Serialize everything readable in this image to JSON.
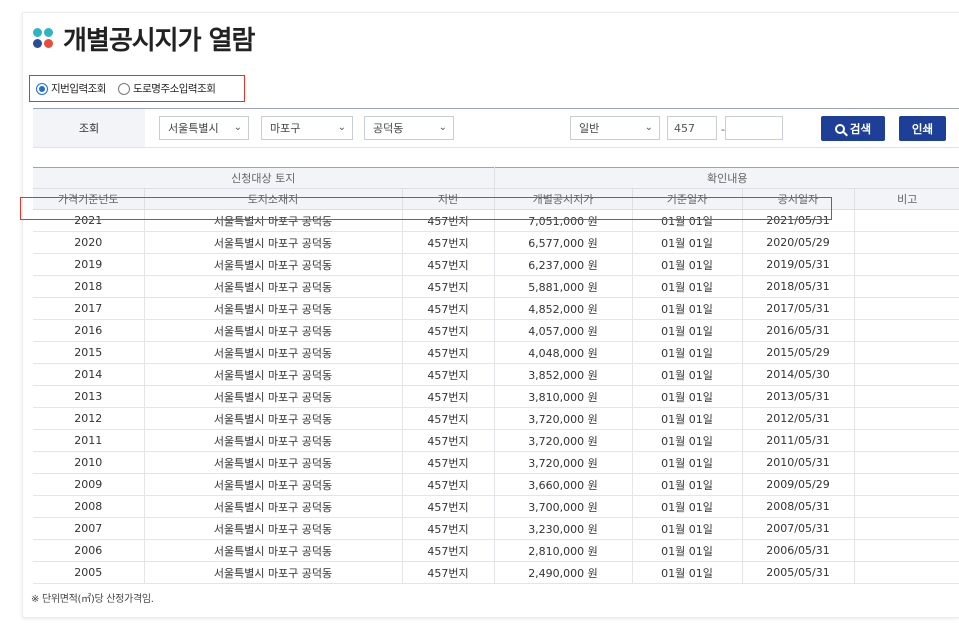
{
  "page": {
    "title": "개별공시지가 열람",
    "footnote": "※ 단위면적(㎡)당 산정가격임."
  },
  "radio": {
    "options": [
      {
        "label": "지번입력조회",
        "selected": true
      },
      {
        "label": "도로명주소입력조회",
        "selected": false
      }
    ]
  },
  "search": {
    "label": "조회",
    "sido": "서울특별시",
    "sigungu": "마포구",
    "dong": "공덕동",
    "land_type": "일반",
    "bonbun": "457",
    "bubun": "",
    "dash": "-",
    "search_button": "검색",
    "print_button": "인쇄"
  },
  "table": {
    "group_headers": [
      "신청대상 토지",
      "확인내용"
    ],
    "columns": [
      "가격기준년도",
      "토지소재지",
      "지번",
      "개별공시지가",
      "기준일자",
      "공시일자",
      "비고"
    ],
    "rows": [
      [
        "2021",
        "서울특별시 마포구 공덕동",
        "457번지",
        "7,051,000 원",
        "01월 01일",
        "2021/05/31",
        ""
      ],
      [
        "2020",
        "서울특별시 마포구 공덕동",
        "457번지",
        "6,577,000 원",
        "01월 01일",
        "2020/05/29",
        ""
      ],
      [
        "2019",
        "서울특별시 마포구 공덕동",
        "457번지",
        "6,237,000 원",
        "01월 01일",
        "2019/05/31",
        ""
      ],
      [
        "2018",
        "서울특별시 마포구 공덕동",
        "457번지",
        "5,881,000 원",
        "01월 01일",
        "2018/05/31",
        ""
      ],
      [
        "2017",
        "서울특별시 마포구 공덕동",
        "457번지",
        "4,852,000 원",
        "01월 01일",
        "2017/05/31",
        ""
      ],
      [
        "2016",
        "서울특별시 마포구 공덕동",
        "457번지",
        "4,057,000 원",
        "01월 01일",
        "2016/05/31",
        ""
      ],
      [
        "2015",
        "서울특별시 마포구 공덕동",
        "457번지",
        "4,048,000 원",
        "01월 01일",
        "2015/05/29",
        ""
      ],
      [
        "2014",
        "서울특별시 마포구 공덕동",
        "457번지",
        "3,852,000 원",
        "01월 01일",
        "2014/05/30",
        ""
      ],
      [
        "2013",
        "서울특별시 마포구 공덕동",
        "457번지",
        "3,810,000 원",
        "01월 01일",
        "2013/05/31",
        ""
      ],
      [
        "2012",
        "서울특별시 마포구 공덕동",
        "457번지",
        "3,720,000 원",
        "01월 01일",
        "2012/05/31",
        ""
      ],
      [
        "2011",
        "서울특별시 마포구 공덕동",
        "457번지",
        "3,720,000 원",
        "01월 01일",
        "2011/05/31",
        ""
      ],
      [
        "2010",
        "서울특별시 마포구 공덕동",
        "457번지",
        "3,720,000 원",
        "01월 01일",
        "2010/05/31",
        ""
      ],
      [
        "2009",
        "서울특별시 마포구 공덕동",
        "457번지",
        "3,660,000 원",
        "01월 01일",
        "2009/05/29",
        ""
      ],
      [
        "2008",
        "서울특별시 마포구 공덕동",
        "457번지",
        "3,700,000 원",
        "01월 01일",
        "2008/05/31",
        ""
      ],
      [
        "2007",
        "서울특별시 마포구 공덕동",
        "457번지",
        "3,230,000 원",
        "01월 01일",
        "2007/05/31",
        ""
      ],
      [
        "2006",
        "서울특별시 마포구 공덕동",
        "457번지",
        "2,810,000 원",
        "01월 01일",
        "2006/05/31",
        ""
      ],
      [
        "2005",
        "서울특별시 마포구 공덕동",
        "457번지",
        "2,490,000 원",
        "01월 01일",
        "2005/05/31",
        ""
      ]
    ]
  },
  "colors": {
    "button_navy": "#1e3f98",
    "highlight_red": "#e0342c",
    "radio_blue": "#1f6fd1"
  }
}
